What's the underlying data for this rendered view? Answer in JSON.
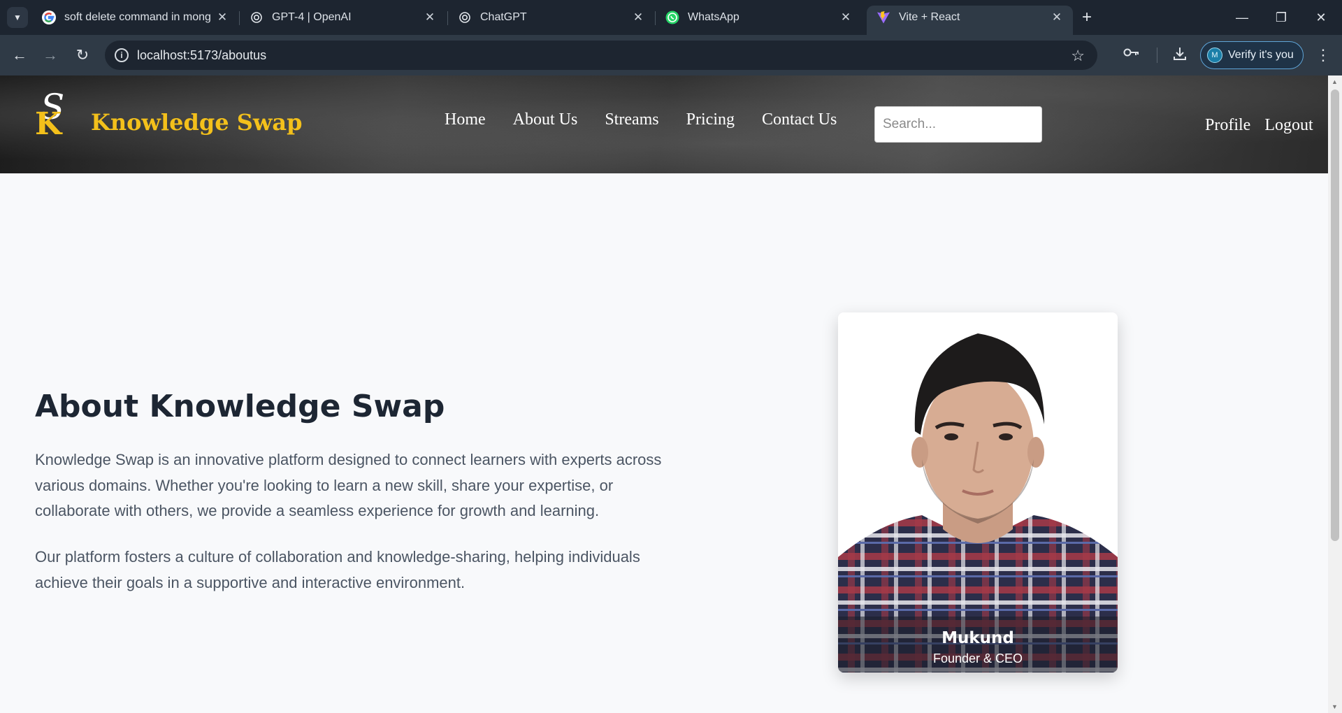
{
  "browser": {
    "tabs": [
      {
        "title": "soft delete command in mongo",
        "icon": "google-icon",
        "active": false
      },
      {
        "title": "GPT-4 | OpenAI",
        "icon": "openai-icon",
        "active": false
      },
      {
        "title": "ChatGPT",
        "icon": "openai-icon",
        "active": false
      },
      {
        "title": "WhatsApp",
        "icon": "whatsapp-icon",
        "active": false
      },
      {
        "title": "Vite + React",
        "icon": "vite-icon",
        "active": true
      }
    ],
    "url": "localhost:5173/aboutus",
    "verify_label": "Verify it's you",
    "profile_initial": "M"
  },
  "site": {
    "brand": "Knowledge Swap",
    "logo_letters": {
      "top": "S",
      "bottom": "K"
    },
    "nav": [
      "Home",
      "About Us",
      "Streams",
      "Pricing",
      "Contact Us"
    ],
    "search_placeholder": "Search...",
    "user_links": [
      "Profile",
      "Logout"
    ],
    "colors": {
      "brand": "#f3c01b",
      "title": "#1d2633",
      "body_text": "#4b5563"
    }
  },
  "about": {
    "title": "About Knowledge Swap",
    "paragraph_1": "Knowledge Swap is an innovative platform designed to connect learners with experts across various domains. Whether you're looking to learn a new skill, share your expertise, or collaborate with others, we provide a seamless experience for growth and learning.",
    "paragraph_2": "Our platform fosters a culture of collaboration and knowledge-sharing, helping individuals achieve their goals in a supportive and interactive environment."
  },
  "founder": {
    "name": "Mukund",
    "role": "Founder & CEO"
  }
}
